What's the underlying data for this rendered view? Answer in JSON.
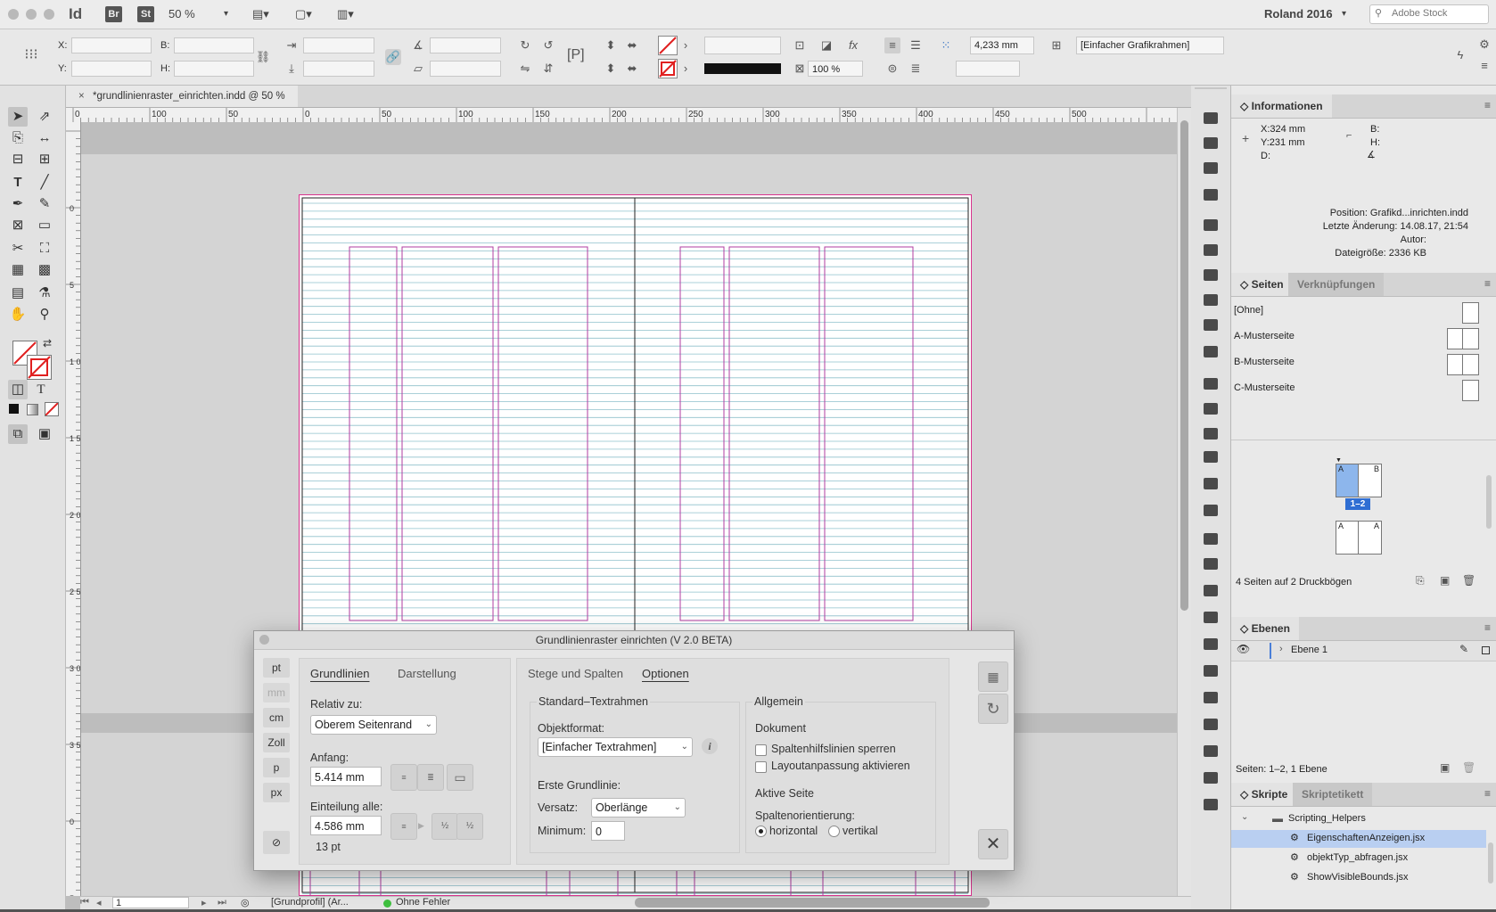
{
  "appbar": {
    "app_logo": "Id",
    "br": "Br",
    "st": "St",
    "zoom": "50 %",
    "workspace": "Roland 2016",
    "stock_placeholder": "Adobe Stock"
  },
  "controlbar": {
    "x_label": "X:",
    "y_label": "Y:",
    "b_label": "B:",
    "h_label": "H:",
    "stroke_weight": "4,233 mm",
    "object_style": "[Einfacher Grafikrahmen]",
    "opacity": "100 %"
  },
  "document": {
    "tab_title": "*grundlinienraster_einrichten.indd @ 50 %",
    "ruler_labels": [
      "0",
      "100",
      "50",
      "0",
      "50",
      "100",
      "150",
      "200",
      "250",
      "300",
      "350",
      "400",
      "450",
      "500"
    ],
    "vruler_labels": [
      "0",
      "5",
      "1 0 0",
      "1 5 0",
      "2 0 0",
      "2 5 0",
      "3 0 0",
      "3 5 0",
      "0",
      "5"
    ],
    "page_number": "1",
    "preflight_profile": "[Grundprofil] (Ar...",
    "preflight_status": "Ohne Fehler"
  },
  "info_panel": {
    "title": "Informationen",
    "x": "X:324 mm",
    "y": "Y:231 mm",
    "d": "D:",
    "b": "B:",
    "h": "H:",
    "position": "Position: Grafikd...inrichten.indd",
    "last_change": "Letzte Änderung: 14.08.17, 21:54",
    "author": "Autor:",
    "filesize": "Dateigröße: 2336 KB"
  },
  "pages_panel": {
    "tab_pages": "Seiten",
    "tab_links": "Verknüpfungen",
    "masters": [
      "[Ohne]",
      "A-Musterseite",
      "B-Musterseite",
      "C-Musterseite"
    ],
    "spread_label": "1–2",
    "summary": "4 Seiten auf 2 Druckbögen",
    "letters": [
      "A",
      "B",
      "A",
      "A"
    ]
  },
  "layers_panel": {
    "title": "Ebenen",
    "layer1": "Ebene 1",
    "summary": "Seiten: 1–2, 1 Ebene"
  },
  "scripts_panel": {
    "tab_scripts": "Skripte",
    "tab_label": "Skriptetikett",
    "folder": "Scripting_Helpers",
    "items": [
      "EigenschaftenAnzeigen.jsx",
      "objektTyp_abfragen.jsx",
      "ShowVisibleBounds.jsx"
    ]
  },
  "dialog": {
    "title": "Grundlinienraster einrichten (V 2.0 BETA)",
    "units": [
      "pt",
      "mm",
      "cm",
      "Zoll",
      "p",
      "px"
    ],
    "tab_grundlinien": "Grundlinien",
    "tab_darstellung": "Darstellung",
    "relativ_label": "Relativ zu:",
    "relativ_value": "Oberem Seitenrand",
    "anfang_label": "Anfang:",
    "anfang_value": "5.414 mm",
    "einteilung_label": "Einteilung alle:",
    "einteilung_value": "4.586 mm",
    "einteilung_pt": "13 pt",
    "tab_stege": "Stege und Spalten",
    "tab_optionen": "Optionen",
    "std_text_title": "Standard–Textrahmen",
    "objektformat_label": "Objektformat:",
    "objektformat_value": "[Einfacher Textrahmen]",
    "erste_grundlinie": "Erste Grundlinie:",
    "versatz_label": "Versatz:",
    "versatz_value": "Oberlänge",
    "minimum_label": "Minimum:",
    "minimum_value": "0",
    "allgemein_title": "Allgemein",
    "dokument_label": "Dokument",
    "check1": "Spaltenhilfslinien sperren",
    "check2": "Layoutanpassung aktivieren",
    "aktive_seite": "Aktive Seite",
    "spaltenorientierung": "Spaltenorientierung:",
    "radio_h": "horizontal",
    "radio_v": "vertikal"
  },
  "colors": {
    "baseline": "#8fc1cc",
    "column_guide": "#b03ca0",
    "margin_guide": "#d9328d",
    "selection": "#3b75c4"
  }
}
